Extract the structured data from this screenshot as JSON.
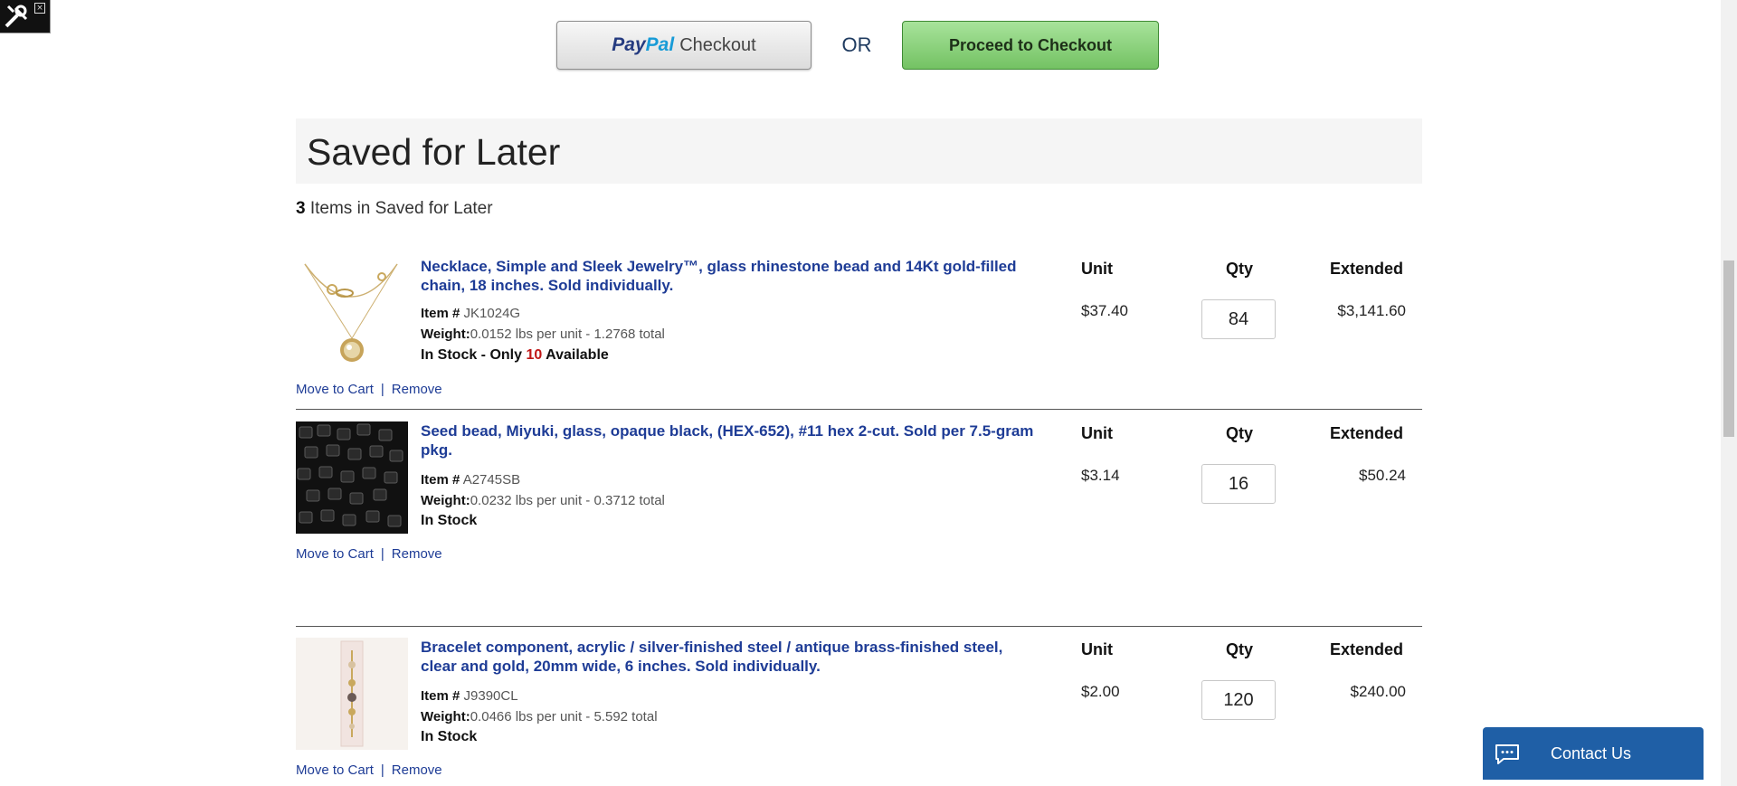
{
  "checkout": {
    "paypal_word1": "Pay",
    "paypal_word2": "Pal",
    "paypal_suffix": "Checkout",
    "or_text": "OR",
    "proceed_label": "Proceed to Checkout"
  },
  "saved": {
    "heading": "Saved for Later",
    "count": "3",
    "count_suffix": " Items in Saved for Later"
  },
  "columns": {
    "unit": "Unit",
    "qty": "Qty",
    "extended": "Extended"
  },
  "labels": {
    "item_prefix": "Item #",
    "weight_prefix": "Weight:",
    "move_to_cart": "Move to Cart",
    "separator": "|",
    "remove": "Remove"
  },
  "items": [
    {
      "title": "Necklace, Simple and Sleek Jewelry™, glass rhinestone bead and 14Kt gold-filled chain, 18 inches. Sold individually.",
      "item_no": "JK1024G",
      "weight": "0.0152 lbs per unit - 1.2768 total",
      "stock_prefix": "In Stock - Only ",
      "stock_num": "10",
      "stock_suffix": " Available",
      "unit": "$37.40",
      "qty": "84",
      "extended": "$3,141.60"
    },
    {
      "title": "Seed bead, Miyuki, glass, opaque black, (HEX-652), #11 hex 2-cut. Sold per 7.5-gram pkg.",
      "item_no": "A2745SB",
      "weight": "0.0232 lbs per unit - 0.3712 total",
      "stock": "In Stock",
      "unit": "$3.14",
      "qty": "16",
      "extended": "$50.24"
    },
    {
      "title": "Bracelet component, acrylic / silver-finished steel / antique brass-finished steel, clear and gold, 20mm wide, 6 inches. Sold individually.",
      "item_no": "J9390CL",
      "weight": "0.0466 lbs per unit - 5.592 total",
      "stock": "In Stock",
      "unit": "$2.00",
      "qty": "120",
      "extended": "$240.00"
    }
  ],
  "contact": {
    "label": "Contact Us"
  },
  "colors": {
    "link": "#1e3c96",
    "contact_bg": "#1f5fa6",
    "proceed_bg": "#8ed47f",
    "stock_red": "#c01515"
  }
}
